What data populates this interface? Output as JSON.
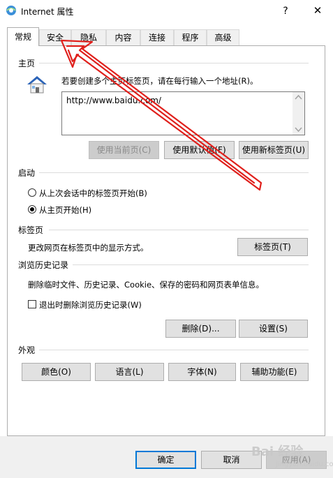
{
  "window": {
    "title": "Internet 属性",
    "help_glyph": "?",
    "close_glyph": "✕"
  },
  "tabs": [
    {
      "label": "常规",
      "active": true
    },
    {
      "label": "安全"
    },
    {
      "label": "隐私"
    },
    {
      "label": "内容"
    },
    {
      "label": "连接"
    },
    {
      "label": "程序"
    },
    {
      "label": "高级"
    }
  ],
  "home_page": {
    "section_label": "主页",
    "instruction": "若要创建多个主页标签页，请在每行输入一个地址(R)。",
    "url_value": "http://www.baidu.com/",
    "buttons": {
      "use_current": "使用当前页(C)",
      "use_default": "使用默认值(F)",
      "use_new_tab": "使用新标签页(U)"
    }
  },
  "startup": {
    "section_label": "启动",
    "option_last_session": "从上次会话中的标签页开始(B)",
    "option_home_page": "从主页开始(H)",
    "selected": "home_page"
  },
  "tabs_section": {
    "section_label": "标签页",
    "description": "更改网页在标签页中的显示方式。",
    "button": "标签页(T)"
  },
  "history": {
    "section_label": "浏览历史记录",
    "description": "删除临时文件、历史记录、Cookie、保存的密码和网页表单信息。",
    "checkbox_label": "退出时删除浏览历史记录(W)",
    "checked": false,
    "delete_button": "删除(D)...",
    "settings_button": "设置(S)"
  },
  "appearance": {
    "section_label": "外观",
    "colors_button": "颜色(O)",
    "languages_button": "语言(L)",
    "fonts_button": "字体(N)",
    "accessibility_button": "辅助功能(E)"
  },
  "footer": {
    "ok_button": "确定",
    "cancel_button": "取消",
    "apply_button": "应用(A)"
  },
  "watermark": {
    "text": "Bai 经验",
    "sub": "jingyan.baidu.com"
  },
  "colors": {
    "annotation_red": "#e0201c",
    "focus_blue": "#0078d7",
    "house_blue": "#2b63b8"
  }
}
